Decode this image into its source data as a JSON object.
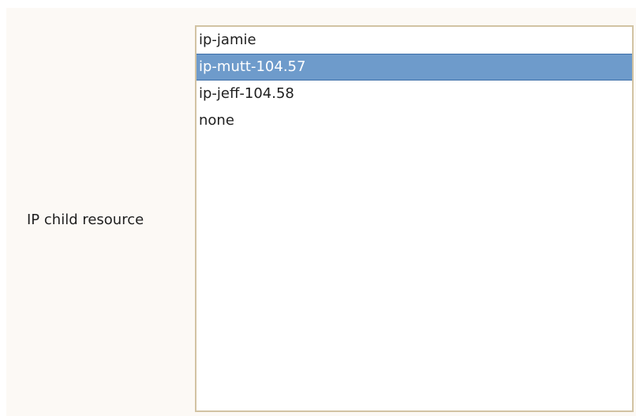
{
  "form": {
    "label": "IP child resource"
  },
  "listbox": {
    "items": [
      {
        "label": "ip-jamie",
        "selected": false
      },
      {
        "label": "ip-mutt-104.57",
        "selected": true
      },
      {
        "label": "ip-jeff-104.58",
        "selected": false
      },
      {
        "label": "none",
        "selected": false
      }
    ]
  },
  "colors": {
    "panel_background": "#fcf9f5",
    "list_border": "#d2c3a3",
    "selection_background": "#6e9bcb",
    "selection_text": "#ffffff",
    "text": "#1f1f1f"
  }
}
